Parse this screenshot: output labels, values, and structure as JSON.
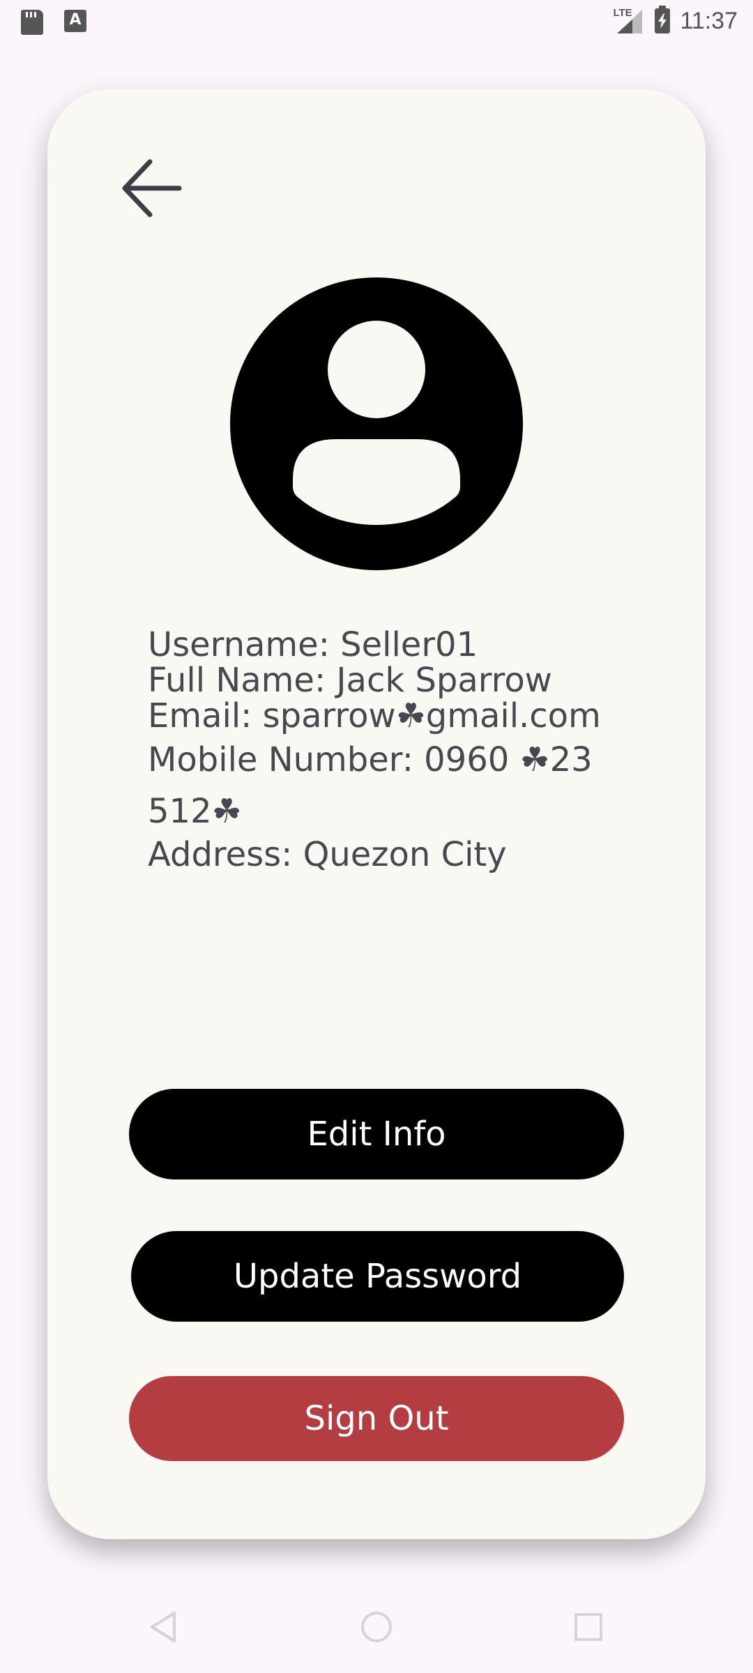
{
  "status_bar": {
    "time": "11:37",
    "network": "LTE",
    "icons": [
      "sd-card-icon",
      "keyboard-a-icon",
      "lte-signal-icon",
      "battery-charging-icon"
    ]
  },
  "profile": {
    "avatar_icon": "account-circle-icon",
    "back_icon": "arrow-left-icon",
    "username": "Username: Seller01",
    "full_name": "Full Name: Jack Sparrow",
    "email": "Email: sparrow☘gmail.com",
    "mobile": "Mobile Number: 0960 ☘23 512☘",
    "address": "Address: Quezon City"
  },
  "buttons": {
    "edit_info": "Edit Info",
    "update_password": "Update Password",
    "sign_out": "Sign Out"
  },
  "colors": {
    "background": "#fcf5fc",
    "card": "#f9f8f3",
    "text": "#4a4650",
    "primary_button": "#000000",
    "sign_out_button": "#b33d40"
  },
  "nav_bar": {
    "icons": [
      "nav-back-icon",
      "nav-home-icon",
      "nav-recents-icon"
    ]
  }
}
